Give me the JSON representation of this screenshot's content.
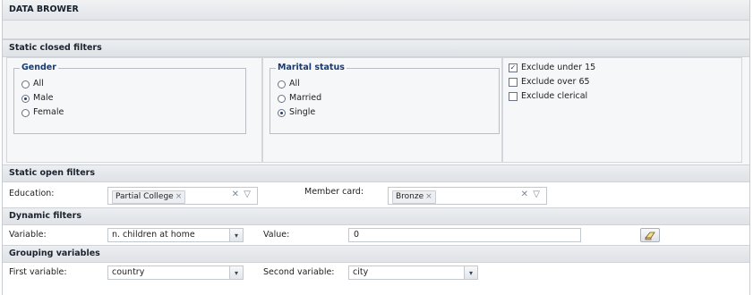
{
  "app": {
    "title": "DATA BROWER"
  },
  "static_closed": {
    "header": "Static closed filters",
    "gender": {
      "legend": "Gender",
      "options": [
        {
          "label": "All",
          "selected": false
        },
        {
          "label": "Male",
          "selected": true
        },
        {
          "label": "Female",
          "selected": false
        }
      ]
    },
    "marital": {
      "legend": "Marital status",
      "options": [
        {
          "label": "All",
          "selected": false
        },
        {
          "label": "Married",
          "selected": false
        },
        {
          "label": "Single",
          "selected": true
        }
      ]
    },
    "checks": [
      {
        "label": "Exclude under 15",
        "checked": true
      },
      {
        "label": "Exclude over 65",
        "checked": false
      },
      {
        "label": "Exclude clerical",
        "checked": false
      }
    ]
  },
  "static_open": {
    "header": "Static open filters",
    "education": {
      "label": "Education:",
      "token": "Partial College"
    },
    "member_card": {
      "label": "Member card:",
      "token": "Bronze"
    }
  },
  "dynamic": {
    "header": "Dynamic filters",
    "variable_label": "Variable:",
    "variable_value": "n. children at home",
    "value_label": "Value:",
    "value_value": "0"
  },
  "grouping": {
    "header": "Grouping variables",
    "first_label": "First variable:",
    "first_value": "country",
    "second_label": "Second variable:",
    "second_value": "city"
  },
  "icons": {
    "token_remove": "close-icon",
    "clear_all": "close-icon",
    "dropdown": "chevron-down-icon",
    "eraser": "eraser-icon"
  },
  "glyphs": {
    "remove": "×",
    "clear": "✕",
    "open": "▽",
    "arrow": "▾",
    "check": "✓"
  },
  "colors": {
    "legend": "#153a78",
    "header_bg": "#e2e4e8",
    "border": "#c3c8cf"
  }
}
